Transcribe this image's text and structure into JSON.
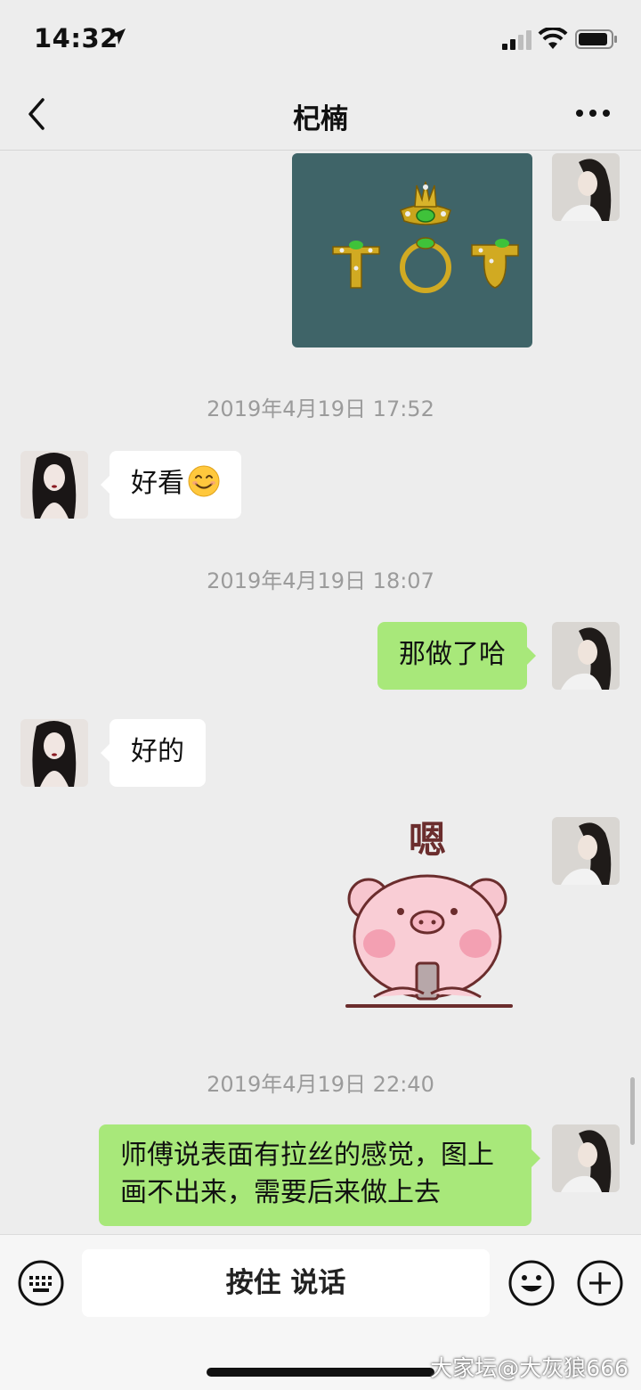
{
  "status_bar": {
    "time": "14:32",
    "icons": [
      "location-arrow-icon",
      "cellular-signal-icon",
      "wifi-icon",
      "battery-icon"
    ]
  },
  "nav": {
    "title": "杞楠",
    "back_icon": "chevron-left-icon",
    "more_icon": "more-dots-icon"
  },
  "messages": [
    {
      "kind": "image",
      "from": "me",
      "description_icon": "ring-design-image"
    },
    {
      "kind": "timestamp",
      "text": "2019年4月19日 17:52"
    },
    {
      "kind": "text",
      "from": "other",
      "text": "好看",
      "emoji": "smile-emoji-icon"
    },
    {
      "kind": "timestamp",
      "text": "2019年4月19日 18:07"
    },
    {
      "kind": "text",
      "from": "me",
      "text": "那做了哈"
    },
    {
      "kind": "text",
      "from": "other",
      "text": "好的"
    },
    {
      "kind": "sticker",
      "from": "me",
      "text": "嗯"
    },
    {
      "kind": "timestamp",
      "text": "2019年4月19日 22:40"
    },
    {
      "kind": "text",
      "from": "me",
      "lines": [
        "师傅说表面有拉丝的感觉，图上",
        "画不出来，需要后来做上去"
      ]
    }
  ],
  "input_bar": {
    "hold_to_talk": "按住 说话",
    "left_icon": "keyboard-icon",
    "right_icons": [
      "emoji-face-icon",
      "plus-icon"
    ]
  },
  "watermark": "大家坛@大灰狼666",
  "colors": {
    "background": "#ededed",
    "outgoing_bubble": "#a8e87a",
    "incoming_bubble": "#ffffff",
    "timestamp_text": "#9b9b9b"
  }
}
